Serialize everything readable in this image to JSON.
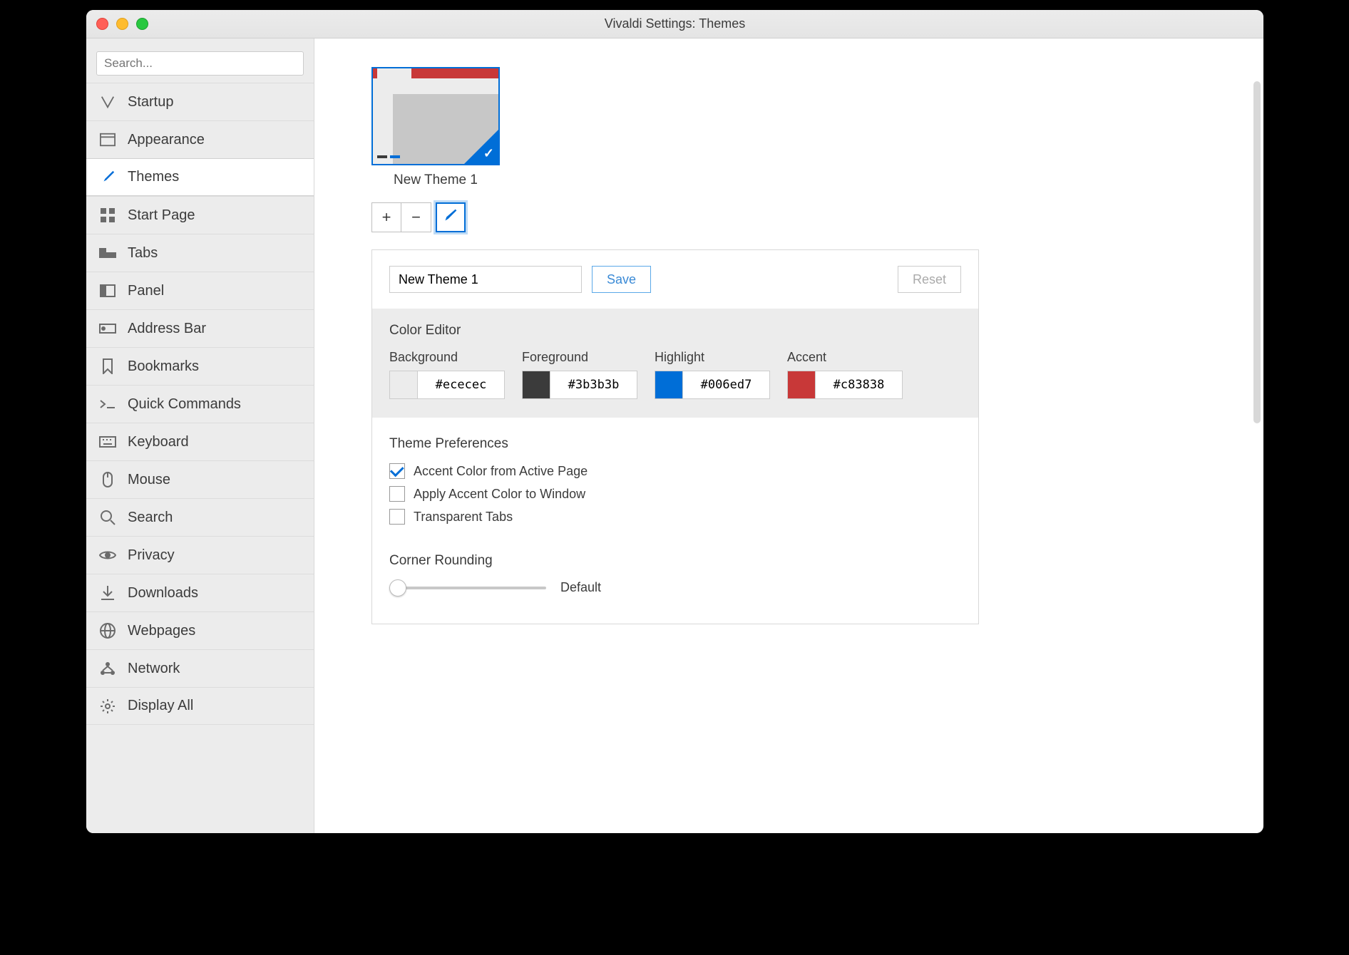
{
  "window_title": "Vivaldi Settings: Themes",
  "search_placeholder": "Search...",
  "sidebar": {
    "items": [
      {
        "label": "Startup",
        "icon": "vivaldi-icon"
      },
      {
        "label": "Appearance",
        "icon": "window-icon"
      },
      {
        "label": "Themes",
        "icon": "brush-icon",
        "active": true
      },
      {
        "label": "Start Page",
        "icon": "grid-icon"
      },
      {
        "label": "Tabs",
        "icon": "tabs-icon"
      },
      {
        "label": "Panel",
        "icon": "panel-icon"
      },
      {
        "label": "Address Bar",
        "icon": "addressbar-icon"
      },
      {
        "label": "Bookmarks",
        "icon": "bookmark-icon"
      },
      {
        "label": "Quick Commands",
        "icon": "quick-icon"
      },
      {
        "label": "Keyboard",
        "icon": "keyboard-icon"
      },
      {
        "label": "Mouse",
        "icon": "mouse-icon"
      },
      {
        "label": "Search",
        "icon": "search-icon"
      },
      {
        "label": "Privacy",
        "icon": "eye-icon"
      },
      {
        "label": "Downloads",
        "icon": "download-icon"
      },
      {
        "label": "Webpages",
        "icon": "globe-icon"
      },
      {
        "label": "Network",
        "icon": "network-icon"
      },
      {
        "label": "Display All",
        "icon": "gear-icon"
      }
    ]
  },
  "theme_thumb_label": "New Theme 1",
  "toolbar": {
    "add": "+",
    "remove": "−",
    "edit": "✎"
  },
  "editor": {
    "name_value": "New Theme 1",
    "save_label": "Save",
    "reset_label": "Reset",
    "color_editor_title": "Color Editor",
    "colors": {
      "background": {
        "label": "Background",
        "hex": "#ececec"
      },
      "foreground": {
        "label": "Foreground",
        "hex": "#3b3b3b"
      },
      "highlight": {
        "label": "Highlight",
        "hex": "#006ed7"
      },
      "accent": {
        "label": "Accent",
        "hex": "#c83838"
      }
    },
    "prefs_title": "Theme Preferences",
    "prefs": [
      {
        "label": "Accent Color from Active Page",
        "checked": true
      },
      {
        "label": "Apply Accent Color to Window",
        "checked": false
      },
      {
        "label": "Transparent Tabs",
        "checked": false
      }
    ],
    "corner_title": "Corner Rounding",
    "corner_value_label": "Default"
  }
}
